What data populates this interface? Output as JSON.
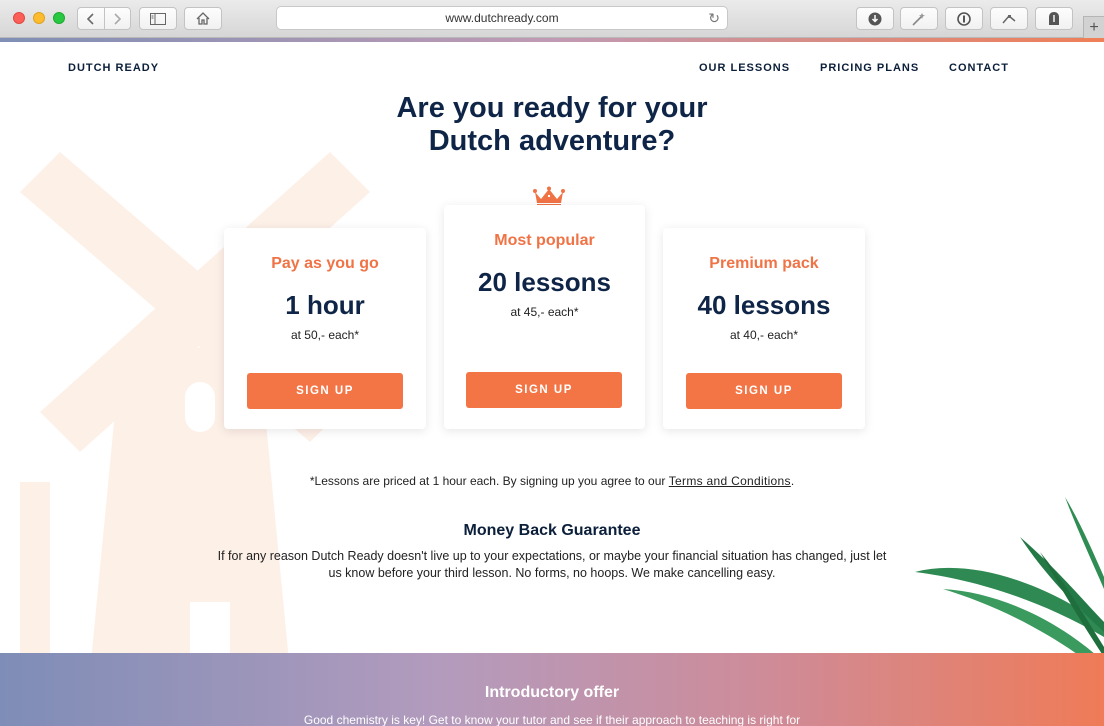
{
  "browser": {
    "url": "www.dutchready.com",
    "icons": [
      "back-icon",
      "forward-icon",
      "sidebar-icon",
      "home-icon",
      "reload-icon",
      "download-icon",
      "magic-icon",
      "password-icon",
      "extension-icon",
      "privacy-icon",
      "add-tab-icon"
    ]
  },
  "header": {
    "brand": "DUTCH READY",
    "nav": [
      "OUR LESSONS",
      "PRICING PLANS",
      "CONTACT"
    ]
  },
  "hero": {
    "line1": "Are you ready for your",
    "line2": "Dutch adventure?"
  },
  "plans": [
    {
      "title": "Pay as you go",
      "quantity": "1 hour",
      "price": "at 50,- each*",
      "button": "SIGN UP"
    },
    {
      "title": "Most popular",
      "quantity": "20 lessons",
      "price": "at 45,- each*",
      "button": "SIGN UP"
    },
    {
      "title": "Premium pack",
      "quantity": "40 lessons",
      "price": "at 40,- each*",
      "button": "SIGN UP"
    }
  ],
  "terms": {
    "before": "*Lessons are priced at 1 hour each. By signing up you agree to our ",
    "link": "Terms and Conditions",
    "after": "."
  },
  "guarantee": {
    "title": "Money Back Guarantee",
    "text": "If for any reason Dutch Ready doesn't live up to your expectations, or maybe your financial situation has changed, just let us know before your third lesson. No forms, no hoops. We make cancelling easy."
  },
  "intro": {
    "title": "Introductory offer",
    "text": "Good chemistry is key! Get to know your tutor and see if their approach to teaching is right for"
  },
  "colors": {
    "accent": "#f37545",
    "navy": "#0f2547"
  }
}
